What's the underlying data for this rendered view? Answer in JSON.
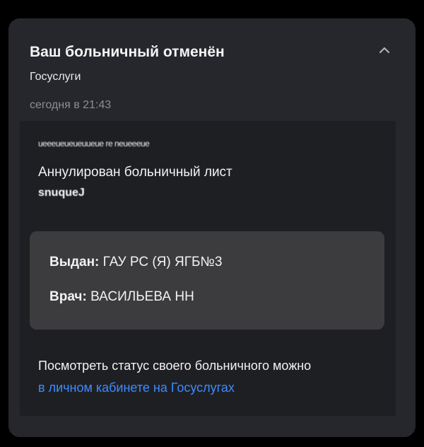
{
  "notification": {
    "title": "Ваш больничный отменён",
    "sender": "Госуслуги",
    "timestamp": "сегодня в 21:43"
  },
  "message": {
    "obscured_line_1": "ueeeueueueuueue re neueeeue",
    "cancel_text": "Аннулирован больничный лист",
    "obscured_line_2": "snuqueJ",
    "issued_label": "Выдан:",
    "issued_value": "ГАУ РС (Я) ЯГБ№3",
    "doctor_label": "Врач:",
    "doctor_value": "ВАСИЛЬЕВА НН",
    "status_text": "Посмотреть статус своего больничного можно",
    "status_link": "в личном кабинете на Госуслугах"
  },
  "colors": {
    "background": "#000000",
    "card": "#26272c",
    "body": "#1e1f23",
    "info_box": "#3c3c3f",
    "link": "#3d8bff",
    "muted": "#8d8e93"
  },
  "icons": {
    "collapse": "chevron-up-icon"
  }
}
